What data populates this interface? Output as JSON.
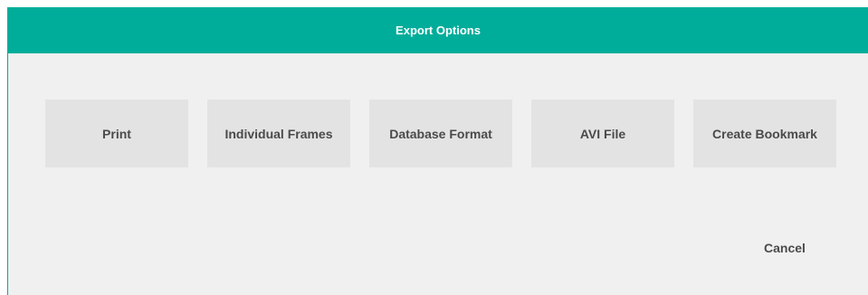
{
  "dialog": {
    "title": "Export Options",
    "accent_color": "#00ad9a",
    "background_color": "#f0f0f0",
    "options": [
      {
        "label": "Print"
      },
      {
        "label": "Individual Frames"
      },
      {
        "label": "Database Format"
      },
      {
        "label": "AVI File"
      },
      {
        "label": "Create Bookmark"
      }
    ],
    "cancel_label": "Cancel"
  }
}
